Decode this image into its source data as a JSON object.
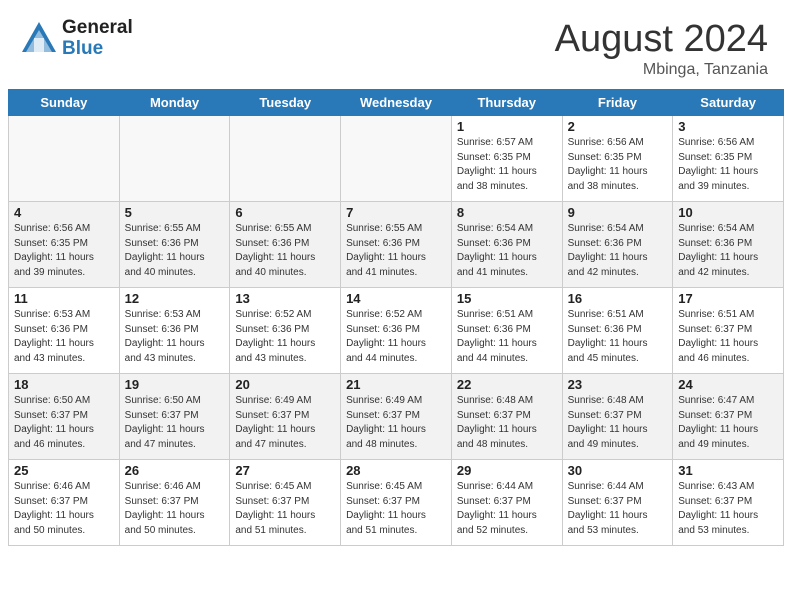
{
  "header": {
    "logo_general": "General",
    "logo_blue": "Blue",
    "month_year": "August 2024",
    "location": "Mbinga, Tanzania"
  },
  "weekdays": [
    "Sunday",
    "Monday",
    "Tuesday",
    "Wednesday",
    "Thursday",
    "Friday",
    "Saturday"
  ],
  "weeks": [
    [
      {
        "day": "",
        "empty": true
      },
      {
        "day": "",
        "empty": true
      },
      {
        "day": "",
        "empty": true
      },
      {
        "day": "",
        "empty": true
      },
      {
        "day": "1",
        "rise": "6:57 AM",
        "set": "6:35 PM",
        "daylight": "11 hours and 38 minutes."
      },
      {
        "day": "2",
        "rise": "6:56 AM",
        "set": "6:35 PM",
        "daylight": "11 hours and 38 minutes."
      },
      {
        "day": "3",
        "rise": "6:56 AM",
        "set": "6:35 PM",
        "daylight": "11 hours and 39 minutes."
      }
    ],
    [
      {
        "day": "4",
        "rise": "6:56 AM",
        "set": "6:35 PM",
        "daylight": "11 hours and 39 minutes."
      },
      {
        "day": "5",
        "rise": "6:55 AM",
        "set": "6:36 PM",
        "daylight": "11 hours and 40 minutes."
      },
      {
        "day": "6",
        "rise": "6:55 AM",
        "set": "6:36 PM",
        "daylight": "11 hours and 40 minutes."
      },
      {
        "day": "7",
        "rise": "6:55 AM",
        "set": "6:36 PM",
        "daylight": "11 hours and 41 minutes."
      },
      {
        "day": "8",
        "rise": "6:54 AM",
        "set": "6:36 PM",
        "daylight": "11 hours and 41 minutes."
      },
      {
        "day": "9",
        "rise": "6:54 AM",
        "set": "6:36 PM",
        "daylight": "11 hours and 42 minutes."
      },
      {
        "day": "10",
        "rise": "6:54 AM",
        "set": "6:36 PM",
        "daylight": "11 hours and 42 minutes."
      }
    ],
    [
      {
        "day": "11",
        "rise": "6:53 AM",
        "set": "6:36 PM",
        "daylight": "11 hours and 43 minutes."
      },
      {
        "day": "12",
        "rise": "6:53 AM",
        "set": "6:36 PM",
        "daylight": "11 hours and 43 minutes."
      },
      {
        "day": "13",
        "rise": "6:52 AM",
        "set": "6:36 PM",
        "daylight": "11 hours and 43 minutes."
      },
      {
        "day": "14",
        "rise": "6:52 AM",
        "set": "6:36 PM",
        "daylight": "11 hours and 44 minutes."
      },
      {
        "day": "15",
        "rise": "6:51 AM",
        "set": "6:36 PM",
        "daylight": "11 hours and 44 minutes."
      },
      {
        "day": "16",
        "rise": "6:51 AM",
        "set": "6:36 PM",
        "daylight": "11 hours and 45 minutes."
      },
      {
        "day": "17",
        "rise": "6:51 AM",
        "set": "6:37 PM",
        "daylight": "11 hours and 46 minutes."
      }
    ],
    [
      {
        "day": "18",
        "rise": "6:50 AM",
        "set": "6:37 PM",
        "daylight": "11 hours and 46 minutes."
      },
      {
        "day": "19",
        "rise": "6:50 AM",
        "set": "6:37 PM",
        "daylight": "11 hours and 47 minutes."
      },
      {
        "day": "20",
        "rise": "6:49 AM",
        "set": "6:37 PM",
        "daylight": "11 hours and 47 minutes."
      },
      {
        "day": "21",
        "rise": "6:49 AM",
        "set": "6:37 PM",
        "daylight": "11 hours and 48 minutes."
      },
      {
        "day": "22",
        "rise": "6:48 AM",
        "set": "6:37 PM",
        "daylight": "11 hours and 48 minutes."
      },
      {
        "day": "23",
        "rise": "6:48 AM",
        "set": "6:37 PM",
        "daylight": "11 hours and 49 minutes."
      },
      {
        "day": "24",
        "rise": "6:47 AM",
        "set": "6:37 PM",
        "daylight": "11 hours and 49 minutes."
      }
    ],
    [
      {
        "day": "25",
        "rise": "6:46 AM",
        "set": "6:37 PM",
        "daylight": "11 hours and 50 minutes."
      },
      {
        "day": "26",
        "rise": "6:46 AM",
        "set": "6:37 PM",
        "daylight": "11 hours and 50 minutes."
      },
      {
        "day": "27",
        "rise": "6:45 AM",
        "set": "6:37 PM",
        "daylight": "11 hours and 51 minutes."
      },
      {
        "day": "28",
        "rise": "6:45 AM",
        "set": "6:37 PM",
        "daylight": "11 hours and 51 minutes."
      },
      {
        "day": "29",
        "rise": "6:44 AM",
        "set": "6:37 PM",
        "daylight": "11 hours and 52 minutes."
      },
      {
        "day": "30",
        "rise": "6:44 AM",
        "set": "6:37 PM",
        "daylight": "11 hours and 53 minutes."
      },
      {
        "day": "31",
        "rise": "6:43 AM",
        "set": "6:37 PM",
        "daylight": "11 hours and 53 minutes."
      }
    ]
  ]
}
